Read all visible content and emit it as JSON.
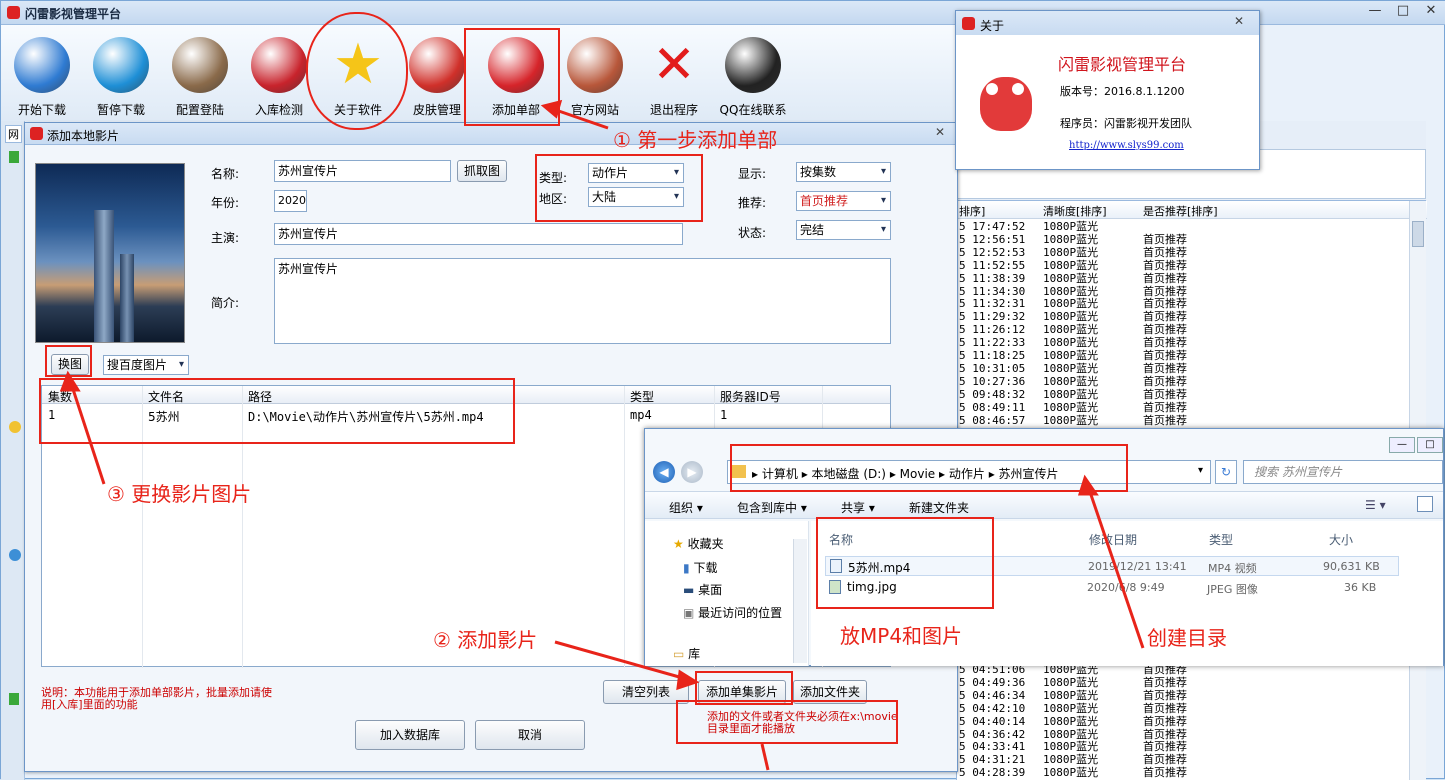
{
  "app": {
    "title": "闪雷影视管理平台",
    "win_minimize": "—",
    "win_maximize": "□",
    "win_close": "✕"
  },
  "toolbar": [
    {
      "label": "开始下载",
      "icon": "globe-download-icon",
      "color": "#2f7bd2"
    },
    {
      "label": "暂停下载",
      "icon": "globe-refresh-icon",
      "color": "#1e8fd6"
    },
    {
      "label": "配置登陆",
      "icon": "users-icon",
      "color": "#8a6a4a"
    },
    {
      "label": "入库检测",
      "icon": "database-add-icon",
      "color": "#c8232c"
    },
    {
      "label": "关于软件",
      "icon": "star-icon",
      "color": "#f5c518"
    },
    {
      "label": "皮肤管理",
      "icon": "skin-figure-icon",
      "color": "#d0302a"
    },
    {
      "label": "添加单部",
      "icon": "disc-add-icon",
      "color": "#d6242a"
    },
    {
      "label": "官方网站",
      "icon": "house-icon",
      "color": "#b8573a"
    },
    {
      "label": "退出程序",
      "icon": "red-x-icon",
      "color": "#e21c1c"
    },
    {
      "label": "QQ在线联系",
      "icon": "qq-penguin-icon",
      "color": "#222222"
    }
  ],
  "left_tab_label": "网",
  "right_grid": {
    "headers": [
      "排序]",
      "清晰度[排序]",
      "是否推荐[排序]"
    ],
    "rows_top": [
      [
        "5 17:47:52",
        "1080P蓝光",
        ""
      ],
      [
        "5 12:56:51",
        "1080P蓝光",
        "首页推荐"
      ],
      [
        "5 12:52:53",
        "1080P蓝光",
        "首页推荐"
      ],
      [
        "5 11:52:55",
        "1080P蓝光",
        "首页推荐"
      ],
      [
        "5 11:38:39",
        "1080P蓝光",
        "首页推荐"
      ],
      [
        "5 11:34:30",
        "1080P蓝光",
        "首页推荐"
      ],
      [
        "5 11:32:31",
        "1080P蓝光",
        "首页推荐"
      ],
      [
        "5 11:29:32",
        "1080P蓝光",
        "首页推荐"
      ],
      [
        "5 11:26:12",
        "1080P蓝光",
        "首页推荐"
      ],
      [
        "5 11:22:33",
        "1080P蓝光",
        "首页推荐"
      ],
      [
        "5 11:18:25",
        "1080P蓝光",
        "首页推荐"
      ],
      [
        "5 10:31:05",
        "1080P蓝光",
        "首页推荐"
      ],
      [
        "5 10:27:36",
        "1080P蓝光",
        "首页推荐"
      ],
      [
        "5 09:48:32",
        "1080P蓝光",
        "首页推荐"
      ],
      [
        "5 08:49:11",
        "1080P蓝光",
        "首页推荐"
      ],
      [
        "5 08:46:57",
        "1080P蓝光",
        "首页推荐"
      ]
    ],
    "rows_bottom": [
      [
        "5 04:51:06",
        "1080P蓝光",
        "首页推荐"
      ],
      [
        "5 04:49:36",
        "1080P蓝光",
        "首页推荐"
      ],
      [
        "5 04:46:34",
        "1080P蓝光",
        "首页推荐"
      ],
      [
        "5 04:42:10",
        "1080P蓝光",
        "首页推荐"
      ],
      [
        "5 04:40:14",
        "1080P蓝光",
        "首页推荐"
      ],
      [
        "5 04:36:42",
        "1080P蓝光",
        "首页推荐"
      ],
      [
        "5 04:33:41",
        "1080P蓝光",
        "首页推荐"
      ],
      [
        "5 04:31:21",
        "1080P蓝光",
        "首页推荐"
      ],
      [
        "5 04:28:39",
        "1080P蓝光",
        "首页推荐"
      ]
    ]
  },
  "dialog": {
    "title": "添加本地影片",
    "close": "✕",
    "name_label": "名称:",
    "name_value": "苏州宣传片",
    "grab_btn": "抓取图",
    "year_label": "年份:",
    "year_value": "2020",
    "actor_label": "主演:",
    "actor_value": "苏州宣传片",
    "intro_label": "简介:",
    "intro_value": "苏州宣传片",
    "type_label": "类型:",
    "type_value": "动作片",
    "region_label": "地区:",
    "region_value": "大陆",
    "display_label": "显示:",
    "display_value": "按集数",
    "recommend_label": "推荐:",
    "recommend_value": "首页推荐",
    "status_label": "状态:",
    "status_value": "完结",
    "change_img_btn": "换图",
    "image_source_value": "搜百度图片",
    "file_headers": [
      "集数",
      "文件名",
      "路径",
      "类型",
      "服务器ID号"
    ],
    "file_rows": [
      [
        "1",
        "5苏州",
        "D:\\Movie\\动作片\\苏州宣传片\\5苏州.mp4",
        "mp4",
        "1"
      ]
    ],
    "note": "说明：本功能用于添加单部影片，批量添加请使用[入库]里面的功能",
    "clear_btn": "清空列表",
    "add_single_btn": "添加单集影片",
    "add_folder_btn": "添加文件夹",
    "add_db_btn": "加入数据库",
    "cancel_btn": "取消",
    "warn": "添加的文件或者文件夹必须在x:\\movie 目录里面才能播放"
  },
  "about": {
    "title": "关于",
    "close": "✕",
    "app_name": "闪雷影视管理平台",
    "version": "版本号：2016.8.1.1200",
    "developer": "程序员：闪雷影视开发团队",
    "url": "http://www.slys99.com"
  },
  "explorer": {
    "breadcrumb": [
      "计算机",
      "本地磁盘 (D:)",
      "Movie",
      "动作片",
      "苏州宣传片"
    ],
    "search_placeholder": "搜索 苏州宣传片",
    "toolbar": [
      "组织 ▾",
      "包含到库中 ▾",
      "共享 ▾",
      "新建文件夹"
    ],
    "nav": [
      "收藏夹",
      "下载",
      "桌面",
      "最近访问的位置",
      "库"
    ],
    "columns": [
      "名称",
      "修改日期",
      "类型",
      "大小"
    ],
    "files": [
      {
        "name": "5苏州.mp4",
        "date": "2019/12/21 13:41",
        "type": "MP4 视频",
        "size": "90,631 KB"
      },
      {
        "name": "timg.jpg",
        "date": "2020/6/8 9:49",
        "type": "JPEG 图像",
        "size": "36 KB"
      }
    ]
  },
  "annotations": {
    "step1": "① 第一步添加单部",
    "step2": "② 添加影片",
    "step3": "③ 更换影片图片",
    "put_files": "放MP4和图片",
    "create_dir": "创建目录"
  }
}
